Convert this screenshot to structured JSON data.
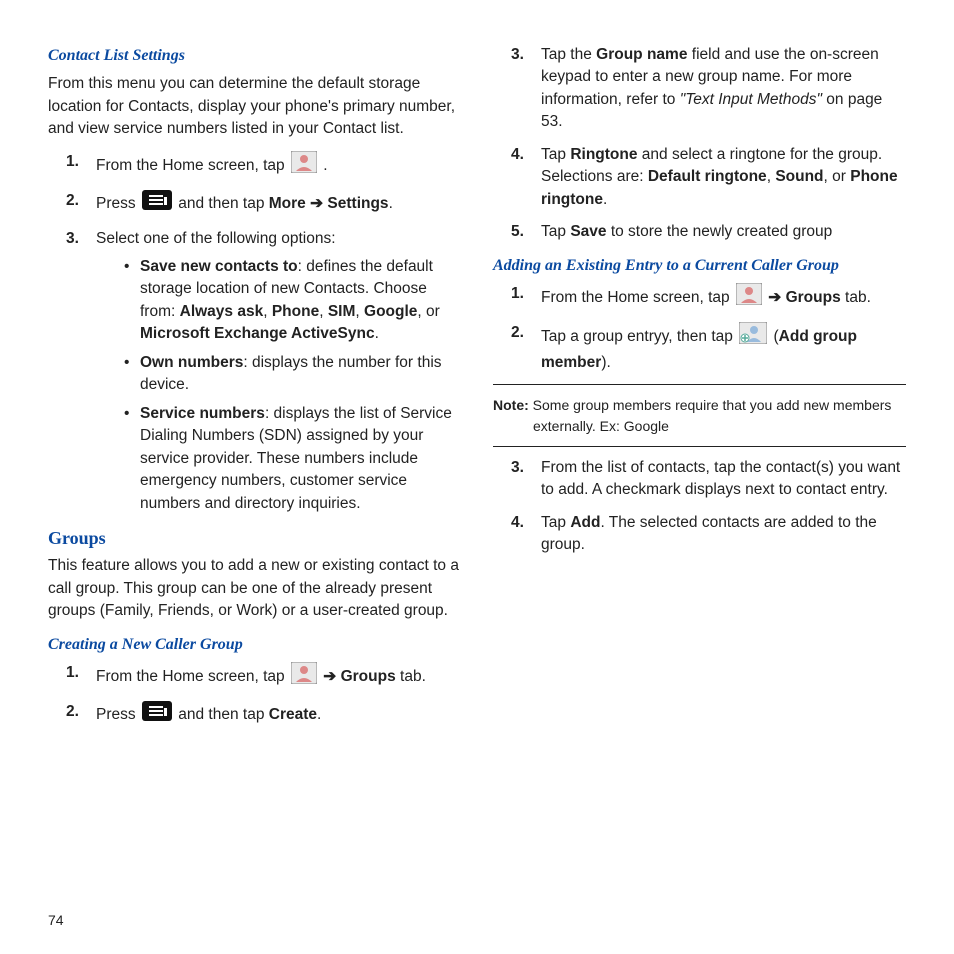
{
  "page_number": "74",
  "icons": {
    "contacts_alt": "Contacts icon",
    "menu_alt": "Menu key icon",
    "add_member_alt": "Add group member icon"
  },
  "left": {
    "h_contact_list": "Contact List Settings",
    "p_intro": "From this menu you can determine the default storage location for Contacts, display your phone's primary number, and view service numbers listed in your Contact list.",
    "s1_a": "From the Home screen, tap ",
    "s1_b": " .",
    "s2_a": "Press ",
    "s2_b": " and then tap ",
    "s2_more": "More",
    "s2_arrow": " ➔ ",
    "s2_settings": "Settings",
    "s2_c": ".",
    "s3": "Select one of the following options:",
    "b1_t": "Save new contacts to",
    "b1_a": ": defines the default storage location of new Contacts. Choose from: ",
    "b1_o1": "Always ask",
    "b1_o2": "Phone",
    "b1_o3": "SIM",
    "b1_o4": "Google",
    "b1_or": ", or ",
    "b1_o5": "Microsoft Exchange ActiveSync",
    "b1_end": ".",
    "b2_t": "Own numbers",
    "b2_a": ": displays the number for this device.",
    "b3_t": "Service numbers",
    "b3_a": ": displays the list of Service Dialing Numbers (SDN) assigned by your service provider. These numbers include emergency numbers, customer service numbers and directory inquiries.",
    "h_groups": "Groups",
    "p_groups": "This feature allows you to add a new or existing contact to a call group. This group can be one of the already present groups (Family, Friends, or Work) or a user-created group.",
    "h_create": "Creating a New Caller Group",
    "c1_a": "From the Home screen, tap ",
    "c1_arrow": " ➔ ",
    "c1_groups": "Groups",
    "c1_b": " tab.",
    "c2_a": "Press ",
    "c2_b": " and then tap ",
    "c2_create": "Create",
    "c2_c": "."
  },
  "right": {
    "r3_a": "Tap the ",
    "r3_gn": "Group name",
    "r3_b": " field and use the on-screen keypad to enter a new group name. For more information, refer to ",
    "r3_ref": "\"Text Input Methods\"",
    "r3_c": "  on page 53.",
    "r4_a": "Tap ",
    "r4_rt": "Ringtone",
    "r4_b": " and select a ringtone for the group. Selections are: ",
    "r4_o1": "Default ringtone",
    "r4_o2": "Sound",
    "r4_or": ", or ",
    "r4_o3": "Phone ringtone",
    "r4_c": ".",
    "r5_a": "Tap ",
    "r5_save": "Save",
    "r5_b": " to store the newly created group",
    "h_add": "Adding an Existing Entry to a Current Caller Group",
    "a1_a": "From the Home screen, tap ",
    "a1_arrow": " ➔ ",
    "a1_groups": "Groups",
    "a1_b": " tab.",
    "a2_a": "Tap a group entryy, then tap ",
    "a2_b": " (",
    "a2_agm": "Add group member",
    "a2_c": ").",
    "note_l": "Note:",
    "note_b": " Some group members require that you add new members externally. Ex: Google",
    "a3": "From the list of contacts, tap the contact(s) you want to add. A checkmark displays next to contact entry.",
    "a4_a": "Tap ",
    "a4_add": "Add",
    "a4_b": ". The selected contacts are added to the group."
  }
}
